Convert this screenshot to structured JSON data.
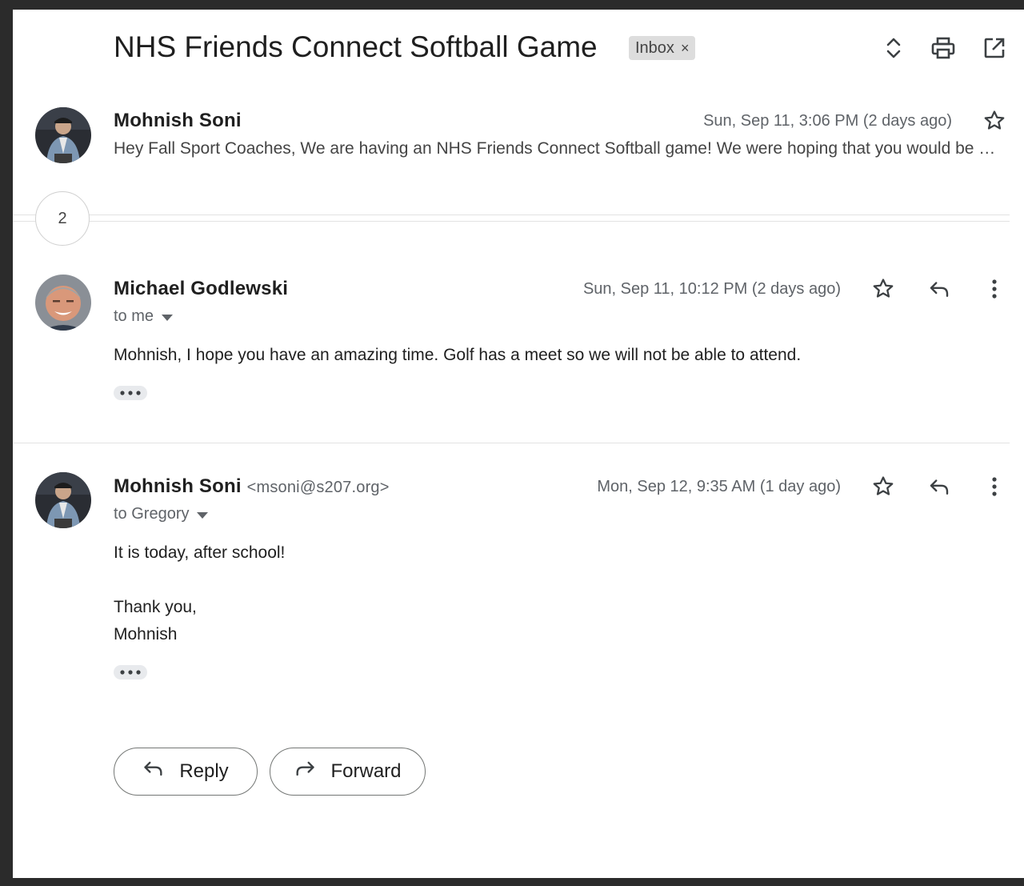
{
  "thread": {
    "subject": "NHS Friends Connect Softball Game",
    "label": "Inbox",
    "label_remove": "×",
    "collapsed_count": "2"
  },
  "header_icons": [
    "expand-collapse-icon",
    "print-icon",
    "open-in-new-window-icon"
  ],
  "messages": [
    {
      "sender": "Mohnish Soni",
      "date": "Sun, Sep 11, 3:06 PM (2 days ago)",
      "snippet": "Hey Fall Sport Coaches, We are having an NHS Friends Connect Softball game! We were hoping that you would be able to..."
    },
    {
      "sender": "Michael Godlewski",
      "date": "Sun, Sep 11, 10:12 PM (2 days ago)",
      "to": "to me",
      "body": "Mohnish, I hope you have an amazing time. Golf has a meet so we will not be able to attend."
    },
    {
      "sender": "Mohnish Soni",
      "email": "<msoni@s207.org>",
      "date": "Mon, Sep 12, 9:35 AM (1 day ago)",
      "to": "to Gregory",
      "body": [
        "It is today, after school!",
        "Thank you,",
        "Mohnish"
      ]
    }
  ],
  "actions": {
    "reply": "Reply",
    "forward": "Forward"
  }
}
